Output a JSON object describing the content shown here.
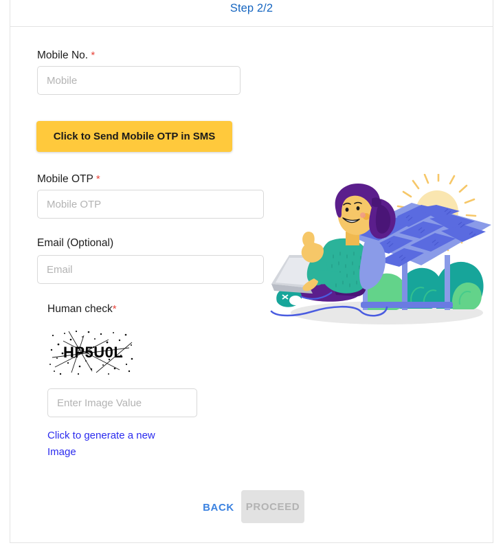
{
  "header": {
    "step_text": "Step 2/2",
    "step_color": "#1565c0"
  },
  "form": {
    "mobile": {
      "label": "Mobile No.",
      "required_mark": "*",
      "placeholder": "Mobile",
      "value": ""
    },
    "send_otp_button": {
      "label": "Click to Send Mobile OTP in SMS",
      "bg_color": "#ffc93c",
      "text_color": "#1a1a1a"
    },
    "mobile_otp": {
      "label": "Mobile OTP",
      "required_mark": "*",
      "placeholder": "Mobile OTP",
      "value": ""
    },
    "email": {
      "label": "Email (Optional)",
      "placeholder": "Email",
      "value": ""
    },
    "human_check": {
      "label": "Human check",
      "required_mark": "*",
      "captcha_text": "HP5U0L",
      "input_placeholder": "Enter Image Value",
      "input_value": "",
      "regenerate_link": "Click to generate a new Image",
      "link_color": "#2a2aee"
    }
  },
  "footer": {
    "back_label": "BACK",
    "back_color": "#3b82e0",
    "proceed_label": "PROCEED",
    "proceed_disabled": true,
    "proceed_bg": "#e2e2e2",
    "proceed_text_color": "#b3b3b3"
  },
  "illustration": {
    "name": "woman-with-laptop-and-solar-panel",
    "colors": {
      "sun_disc": "#fae6b0",
      "sun_rays": "#f6c768",
      "panel_frame": "#8a9be8",
      "panel_cell": "#5a6be0",
      "sweater": "#2bb39a",
      "hair": "#5b1e8c",
      "pants": "#5b1e8c",
      "skin": "#f6c768",
      "foliage_dark": "#17a59a",
      "foliage_light": "#63d38a",
      "laptop": "#d3d6dc",
      "ground": "#e6e6e6",
      "cable": "#4a5ce0"
    }
  }
}
